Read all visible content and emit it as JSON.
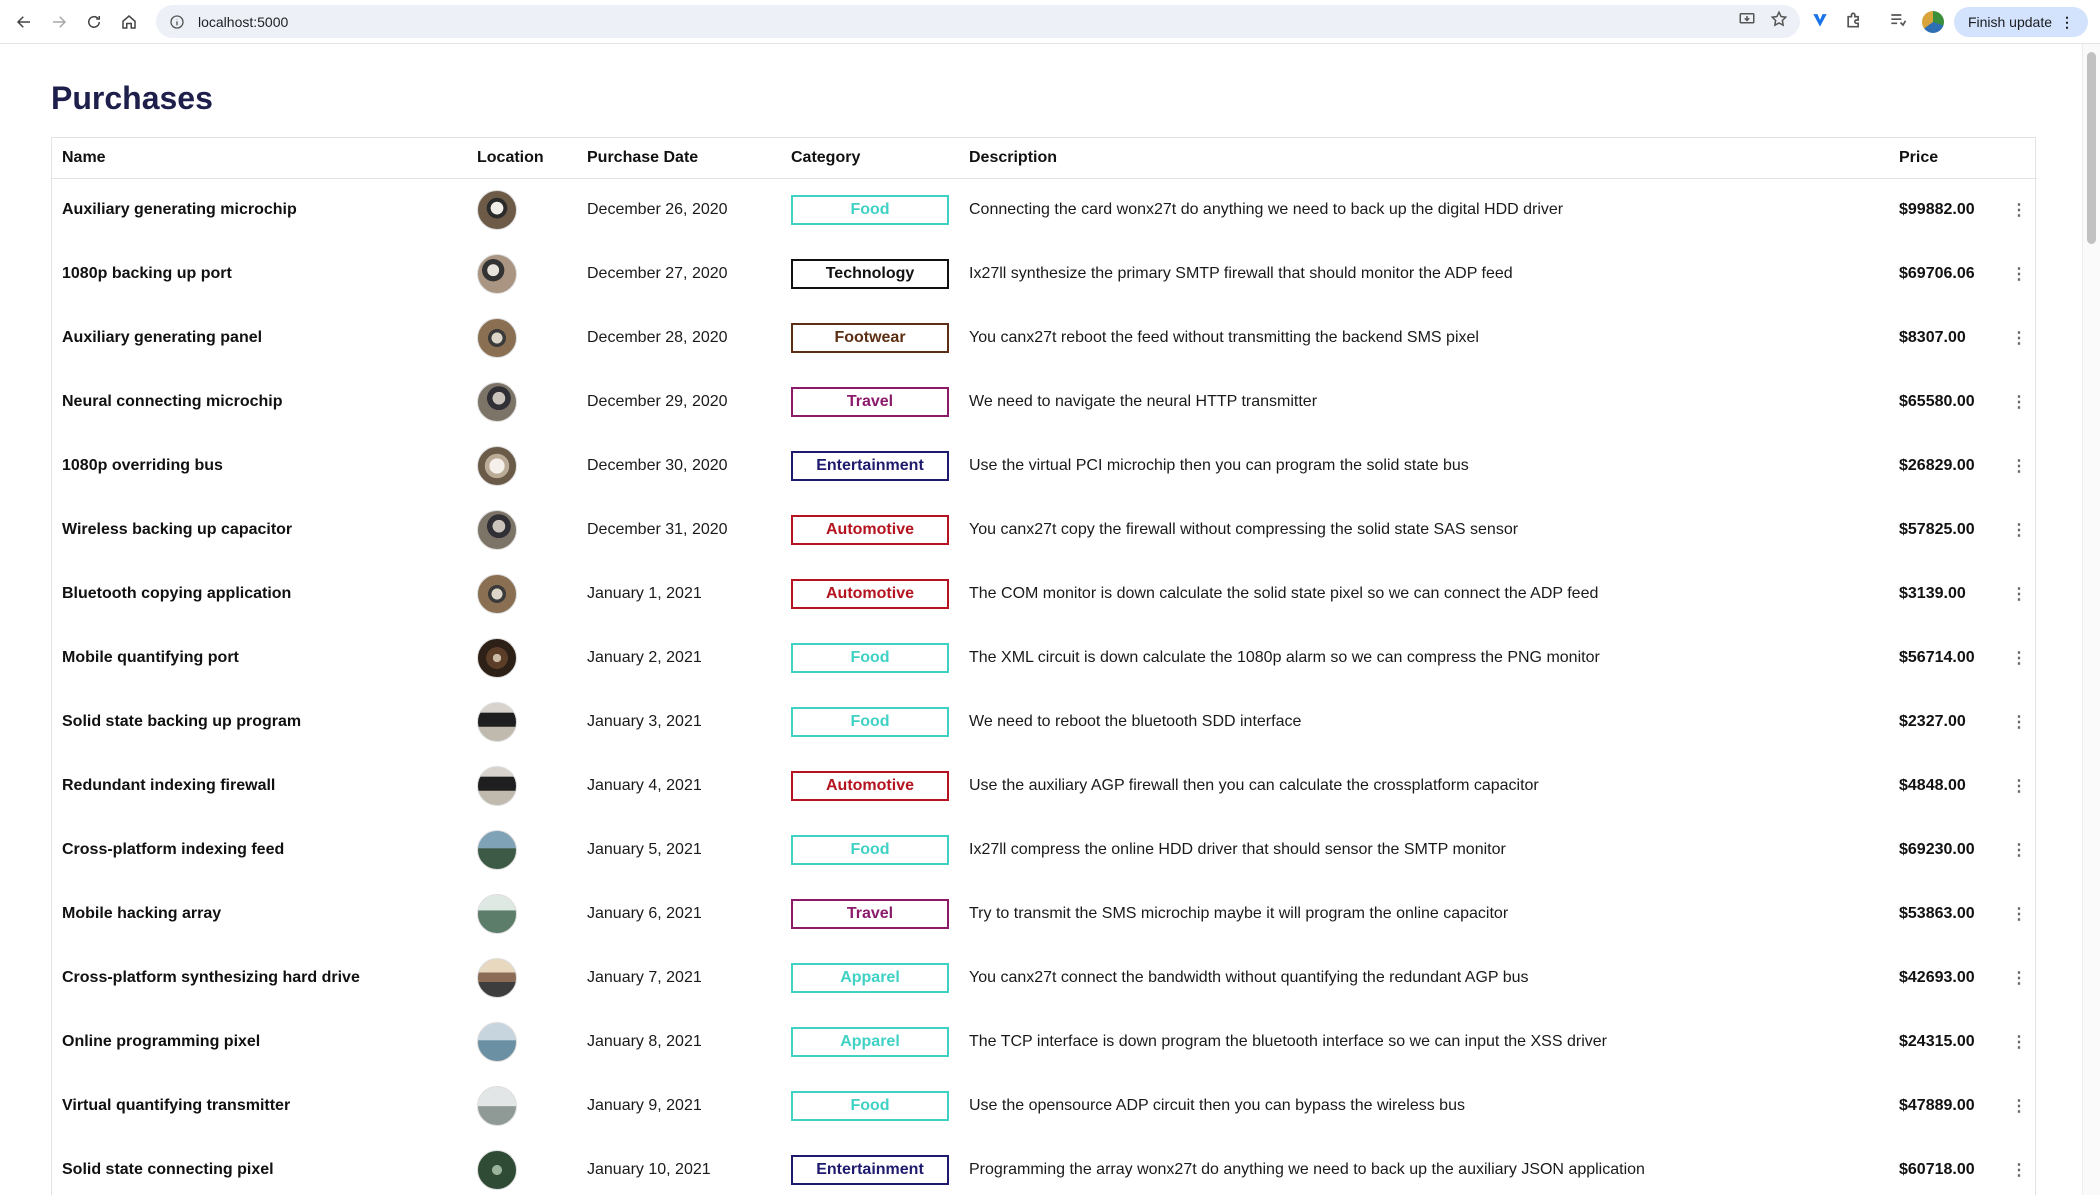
{
  "browser": {
    "url": "localhost:5000",
    "finish_update_label": "Finish update"
  },
  "page": {
    "title": "Purchases"
  },
  "columns": [
    "Name",
    "Location",
    "Purchase Date",
    "Category",
    "Description",
    "Price"
  ],
  "category_colors": {
    "Food": "#3fd1c4",
    "Technology": "#111111",
    "Footwear": "#5c2e14",
    "Travel": "#8c1a6b",
    "Entertainment": "#1e1b6e",
    "Automotive": "#b4131f",
    "Apparel": "#3fd1c4"
  },
  "rows": [
    {
      "name": "Auxiliary generating microchip",
      "thumb": "laptop-dark",
      "date": "December 26, 2020",
      "category": "Food",
      "description": "Connecting the card wonx27t do anything we need to back up the digital HDD driver",
      "price": "$99882.00"
    },
    {
      "name": "1080p backing up port",
      "thumb": "laptop-hands",
      "date": "December 27, 2020",
      "category": "Technology",
      "description": "Ix27ll synthesize the primary SMTP firewall that should monitor the ADP feed",
      "price": "$69706.06"
    },
    {
      "name": "Auxiliary generating panel",
      "thumb": "laptop-desk",
      "date": "December 28, 2020",
      "category": "Footwear",
      "description": "You canx27t reboot the feed without transmitting the backend SMS pixel",
      "price": "$8307.00"
    },
    {
      "name": "Neural connecting microchip",
      "thumb": "laptop-person",
      "date": "December 29, 2020",
      "category": "Travel",
      "description": "We need to navigate the neural HTTP transmitter",
      "price": "$65580.00"
    },
    {
      "name": "1080p overriding bus",
      "thumb": "laptop-light",
      "date": "December 30, 2020",
      "category": "Entertainment",
      "description": "Use the virtual PCI microchip then you can program the solid state bus",
      "price": "$26829.00"
    },
    {
      "name": "Wireless backing up capacitor",
      "thumb": "laptop-person",
      "date": "December 31, 2020",
      "category": "Automotive",
      "description": "You canx27t copy the firewall without compressing the solid state SAS sensor",
      "price": "$57825.00"
    },
    {
      "name": "Bluetooth copying application",
      "thumb": "laptop-desk",
      "date": "January 1, 2021",
      "category": "Automotive",
      "description": "The COM monitor is down calculate the solid state pixel so we can connect the ADP feed",
      "price": "$3139.00"
    },
    {
      "name": "Mobile quantifying port",
      "thumb": "laptop-brown",
      "date": "January 2, 2021",
      "category": "Food",
      "description": "The XML circuit is down calculate the 1080p alarm so we can compress the PNG monitor",
      "price": "$56714.00"
    },
    {
      "name": "Solid state backing up program",
      "thumb": "laptop-screen",
      "date": "January 3, 2021",
      "category": "Food",
      "description": "We need to reboot the bluetooth SDD interface",
      "price": "$2327.00"
    },
    {
      "name": "Redundant indexing firewall",
      "thumb": "laptop-screen",
      "date": "January 4, 2021",
      "category": "Automotive",
      "description": "Use the auxiliary AGP firewall then you can calculate the crossplatform capacitor",
      "price": "$4848.00"
    },
    {
      "name": "Cross-platform indexing feed",
      "thumb": "mountain",
      "date": "January 5, 2021",
      "category": "Food",
      "description": "Ix27ll compress the online HDD driver that should sensor the SMTP monitor",
      "price": "$69230.00"
    },
    {
      "name": "Mobile hacking array",
      "thumb": "landscape",
      "date": "January 6, 2021",
      "category": "Travel",
      "description": "Try to transmit the SMS microchip maybe it will program the online capacitor",
      "price": "$53863.00"
    },
    {
      "name": "Cross-platform synthesizing hard drive",
      "thumb": "sunset",
      "date": "January 7, 2021",
      "category": "Apparel",
      "description": "You canx27t connect the bandwidth without quantifying the redundant AGP bus",
      "price": "$42693.00"
    },
    {
      "name": "Online programming pixel",
      "thumb": "lake",
      "date": "January 8, 2021",
      "category": "Apparel",
      "description": "The TCP interface is down program the bluetooth interface so we can input the XSS driver",
      "price": "$24315.00"
    },
    {
      "name": "Virtual quantifying transmitter",
      "thumb": "mist",
      "date": "January 9, 2021",
      "category": "Food",
      "description": "Use the opensource ADP circuit then you can bypass the wireless bus",
      "price": "$47889.00"
    },
    {
      "name": "Solid state connecting pixel",
      "thumb": "forest",
      "date": "January 10, 2021",
      "category": "Entertainment",
      "description": "Programming the array wonx27t do anything we need to back up the auxiliary JSON application",
      "price": "$60718.00"
    }
  ]
}
